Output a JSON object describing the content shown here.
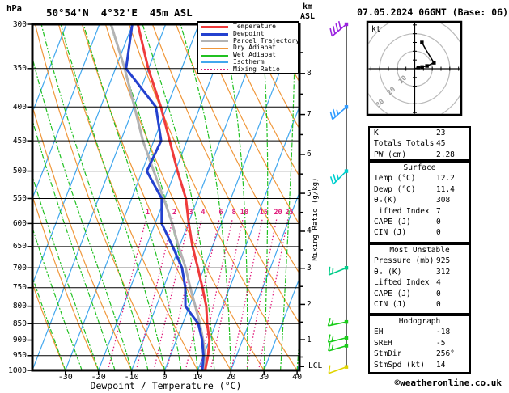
{
  "header": {
    "pressure_unit": "hPa",
    "station": "50°54'N  4°32'E  45m ASL",
    "altitude_unit_top": "km",
    "altitude_unit_bottom": "ASL",
    "datetime": "07.05.2024 06GMT (Base: 06)"
  },
  "axes": {
    "x_label": "Dewpoint / Temperature (°C)",
    "mixing_ratio_axis_label": "Mixing Ratio (g/kg)",
    "lcl_label": "LCL",
    "hodograph_unit": "kt"
  },
  "legend": {
    "items": [
      {
        "label": "Temperature",
        "color": "#ef3b3b",
        "thick": true,
        "dotted": false
      },
      {
        "label": "Dewpoint",
        "color": "#2441cf",
        "thick": true,
        "dotted": false
      },
      {
        "label": "Parcel Trajectory",
        "color": "#b3b3b3",
        "thick": true,
        "dotted": false
      },
      {
        "label": "Dry Adiabat",
        "color": "#f0973a",
        "thick": false,
        "dotted": false
      },
      {
        "label": "Wet Adiabat",
        "color": "#21c121",
        "thick": false,
        "dotted": false
      },
      {
        "label": "Isotherm",
        "color": "#41a7ee",
        "thick": false,
        "dotted": false
      },
      {
        "label": "Mixing Ratio",
        "color": "#e01d7c",
        "thick": false,
        "dotted": true
      }
    ]
  },
  "chart_data": {
    "type": "skewt_logp",
    "pressure_ticks_hpa": [
      300,
      350,
      400,
      450,
      500,
      550,
      600,
      650,
      700,
      750,
      800,
      850,
      900,
      950,
      1000
    ],
    "temp_ticks_c": [
      -30,
      -20,
      -10,
      0,
      10,
      20,
      30,
      40
    ],
    "km_ticks": [
      1,
      2,
      3,
      4,
      5,
      6,
      7,
      8
    ],
    "mixing_ratio_g_kg": [
      1,
      2,
      3,
      4,
      6,
      8,
      10,
      15,
      20,
      25
    ],
    "isotherm_step_c": 10,
    "dry_adiabat_step_c": 10,
    "wet_adiabat_step_c": 5,
    "lcl_pressure_hpa": 986,
    "series": {
      "temperature_c": [
        [
          300,
          -48.4
        ],
        [
          350,
          -40.1
        ],
        [
          400,
          -31.8
        ],
        [
          450,
          -25.2
        ],
        [
          500,
          -19.3
        ],
        [
          550,
          -13.6
        ],
        [
          600,
          -9.8
        ],
        [
          650,
          -6.0
        ],
        [
          700,
          -1.9
        ],
        [
          750,
          1.8
        ],
        [
          800,
          5.1
        ],
        [
          850,
          7.4
        ],
        [
          900,
          10.0
        ],
        [
          950,
          11.4
        ],
        [
          1000,
          12.2
        ]
      ],
      "dewpoint_c": [
        [
          300,
          -50.1
        ],
        [
          350,
          -46.8
        ],
        [
          400,
          -33.3
        ],
        [
          450,
          -27.8
        ],
        [
          500,
          -28.6
        ],
        [
          550,
          -20.9
        ],
        [
          600,
          -18.0
        ],
        [
          650,
          -12.0
        ],
        [
          700,
          -6.7
        ],
        [
          750,
          -3.4
        ],
        [
          800,
          -1.2
        ],
        [
          850,
          4.7
        ],
        [
          900,
          7.8
        ],
        [
          950,
          10.0
        ],
        [
          1000,
          11.4
        ]
      ],
      "parcel_c": [
        [
          300,
          -56.5
        ],
        [
          350,
          -47.2
        ],
        [
          400,
          -39.8
        ],
        [
          450,
          -33.3
        ],
        [
          500,
          -26.5
        ],
        [
          550,
          -20.3
        ],
        [
          600,
          -14.8
        ],
        [
          650,
          -10.2
        ],
        [
          700,
          -5.6
        ],
        [
          750,
          -1.9
        ],
        [
          800,
          1.8
        ],
        [
          850,
          5.2
        ],
        [
          900,
          8.1
        ],
        [
          950,
          10.4
        ],
        [
          1000,
          12.3
        ]
      ]
    },
    "wind_barbs": [
      {
        "pressure_hpa": 300,
        "speed_kt": 40,
        "dir_deg": 230,
        "color": "#9a22e0"
      },
      {
        "pressure_hpa": 400,
        "speed_kt": 25,
        "dir_deg": 228,
        "color": "#2f9bff"
      },
      {
        "pressure_hpa": 500,
        "speed_kt": 25,
        "dir_deg": 225,
        "color": "#00cfcf"
      },
      {
        "pressure_hpa": 700,
        "speed_kt": 15,
        "dir_deg": 248,
        "color": "#00cc88"
      },
      {
        "pressure_hpa": 845,
        "speed_kt": 15,
        "dir_deg": 258,
        "color": "#19cc19"
      },
      {
        "pressure_hpa": 893,
        "speed_kt": 15,
        "dir_deg": 256,
        "color": "#19cc19"
      },
      {
        "pressure_hpa": 918,
        "speed_kt": 15,
        "dir_deg": 254,
        "color": "#19cc19"
      },
      {
        "pressure_hpa": 988,
        "speed_kt": 10,
        "dir_deg": 250,
        "color": "#e0d400"
      }
    ],
    "hodograph": {
      "rings_kt": [
        10,
        20,
        30
      ],
      "ring_labels": [
        "10",
        "20",
        "30"
      ],
      "trace_kt": [
        [
          0,
          0
        ],
        [
          2,
          0.7
        ],
        [
          4.2,
          1.0
        ],
        [
          7,
          1.6
        ],
        [
          11,
          3.4
        ],
        [
          6.4,
          10.8
        ],
        [
          4.1,
          15
        ]
      ],
      "marker_indices": [
        1,
        2,
        3,
        4,
        6
      ],
      "storm_dir_deg": 256,
      "storm_speed_kt": 14
    }
  },
  "panel": {
    "boxes": [
      {
        "title": "",
        "rows": [
          {
            "label": "K",
            "value": "23"
          },
          {
            "label": "Totals Totals",
            "value": "45"
          },
          {
            "label": "PW (cm)",
            "value": "2.28"
          }
        ]
      },
      {
        "title": "Surface",
        "rows": [
          {
            "label": "Temp (°C)",
            "value": "12.2"
          },
          {
            "label": "Dewp (°C)",
            "value": "11.4"
          },
          {
            "label": "θₑ(K)",
            "value": "308"
          },
          {
            "label": "Lifted Index",
            "value": "7"
          },
          {
            "label": "CAPE (J)",
            "value": "0"
          },
          {
            "label": "CIN (J)",
            "value": "0"
          }
        ]
      },
      {
        "title": "Most Unstable",
        "rows": [
          {
            "label": "Pressure (mb)",
            "value": "925"
          },
          {
            "label": "θₑ (K)",
            "value": "312"
          },
          {
            "label": "Lifted Index",
            "value": "4"
          },
          {
            "label": "CAPE (J)",
            "value": "0"
          },
          {
            "label": "CIN (J)",
            "value": "0"
          }
        ]
      },
      {
        "title": "Hodograph",
        "rows": [
          {
            "label": "EH",
            "value": "-18"
          },
          {
            "label": "SREH",
            "value": "-5"
          },
          {
            "label": "StmDir",
            "value": "256°"
          },
          {
            "label": "StmSpd (kt)",
            "value": "14"
          }
        ]
      }
    ]
  },
  "footer": {
    "credit": "©weatheronline.co.uk"
  }
}
